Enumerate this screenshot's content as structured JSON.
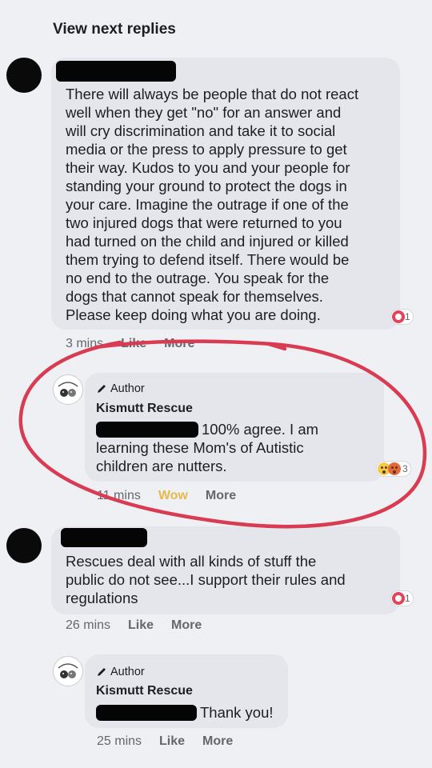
{
  "view_next_replies": "View next replies",
  "comment1": {
    "text_lines": [
      "There will always be people that do not react",
      "well when they get \"no\" for an answer and",
      "will cry discrimination and take it to social",
      "media or the press to apply pressure to get",
      "their way. Kudos to you and your people for",
      "standing your ground to protect the dogs in",
      "your care. Imagine the outrage if one of the",
      "two injured dogs that were returned to you",
      "had turned on the child and injured or killed",
      "them trying to defend itself. There would be",
      "no end to the outrage. You speak for the",
      "dogs that cannot speak for themselves.",
      "Please keep doing what you are doing."
    ],
    "reaction_count": "1",
    "time": "3 mins",
    "like": "Like",
    "more": "More"
  },
  "reply1": {
    "author_badge": "Author",
    "name": "Kismutt Rescue",
    "line1": "100% agree. I am",
    "line2": "learning these Mom's of Autistic",
    "line3": "children are nutters.",
    "reaction_count": "3",
    "time": "11 mins",
    "reaction": "Wow",
    "more": "More"
  },
  "comment2": {
    "text_lines": [
      "Rescues deal with all kinds of stuff the",
      "public do not see...I support their rules and",
      "regulations"
    ],
    "reaction_count": "1",
    "time": "26 mins",
    "like": "Like",
    "more": "More"
  },
  "reply2": {
    "author_badge": "Author",
    "name": "Kismutt Rescue",
    "line1": "Thank you!",
    "time": "25 mins",
    "like": "Like",
    "more": "More"
  },
  "colors": {
    "annotation_circle": "#d93b52",
    "wow": "#e5b94a",
    "bubble": "#e4e6eb"
  }
}
